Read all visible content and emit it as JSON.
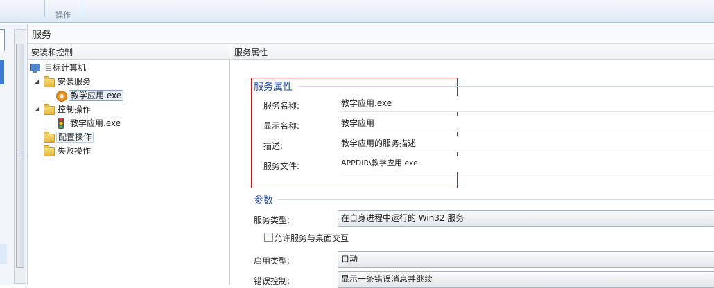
{
  "ribbon": {
    "group_label": "操作"
  },
  "header": {
    "title": "服务"
  },
  "tree_panel": {
    "title": "安装和控制",
    "items": [
      {
        "label": "目标计算机",
        "icon": "computer-icon"
      },
      {
        "label": "安装服务",
        "icon": "folder-icon"
      },
      {
        "label": "教学应用.exe",
        "icon": "service-gear-icon"
      },
      {
        "label": "控制操作",
        "icon": "folder-icon"
      },
      {
        "label": "教学应用.exe",
        "icon": "traffic-light-icon"
      },
      {
        "label": "配置操作",
        "icon": "folder-icon"
      },
      {
        "label": "失败操作",
        "icon": "folder-icon"
      }
    ]
  },
  "props_panel": {
    "title": "服务属性",
    "service_section": {
      "title": "服务属性",
      "fields": [
        {
          "label": "服务名称:",
          "value": "教学应用.exe"
        },
        {
          "label": "显示名称:",
          "value": "教学应用"
        },
        {
          "label": "描述:",
          "value": "教学应用的服务描述"
        },
        {
          "label": "服务文件:",
          "value": "APPDIR\\教学应用.exe"
        }
      ]
    },
    "params_section": {
      "title": "参数",
      "service_type_label": "服务类型:",
      "service_type_value": "在自身进程中运行的 Win32 服务",
      "allow_interact_label": "允许服务与桌面交互",
      "start_type_label": "启用类型:",
      "start_type_value": "自动",
      "error_control_label": "错误控制:",
      "error_control_value": "显示一条错误消息并继续"
    }
  },
  "colors": {
    "section_title": "#1f4aa0",
    "highlight_box": "#d0141b",
    "selection": "#e5f0fb"
  }
}
